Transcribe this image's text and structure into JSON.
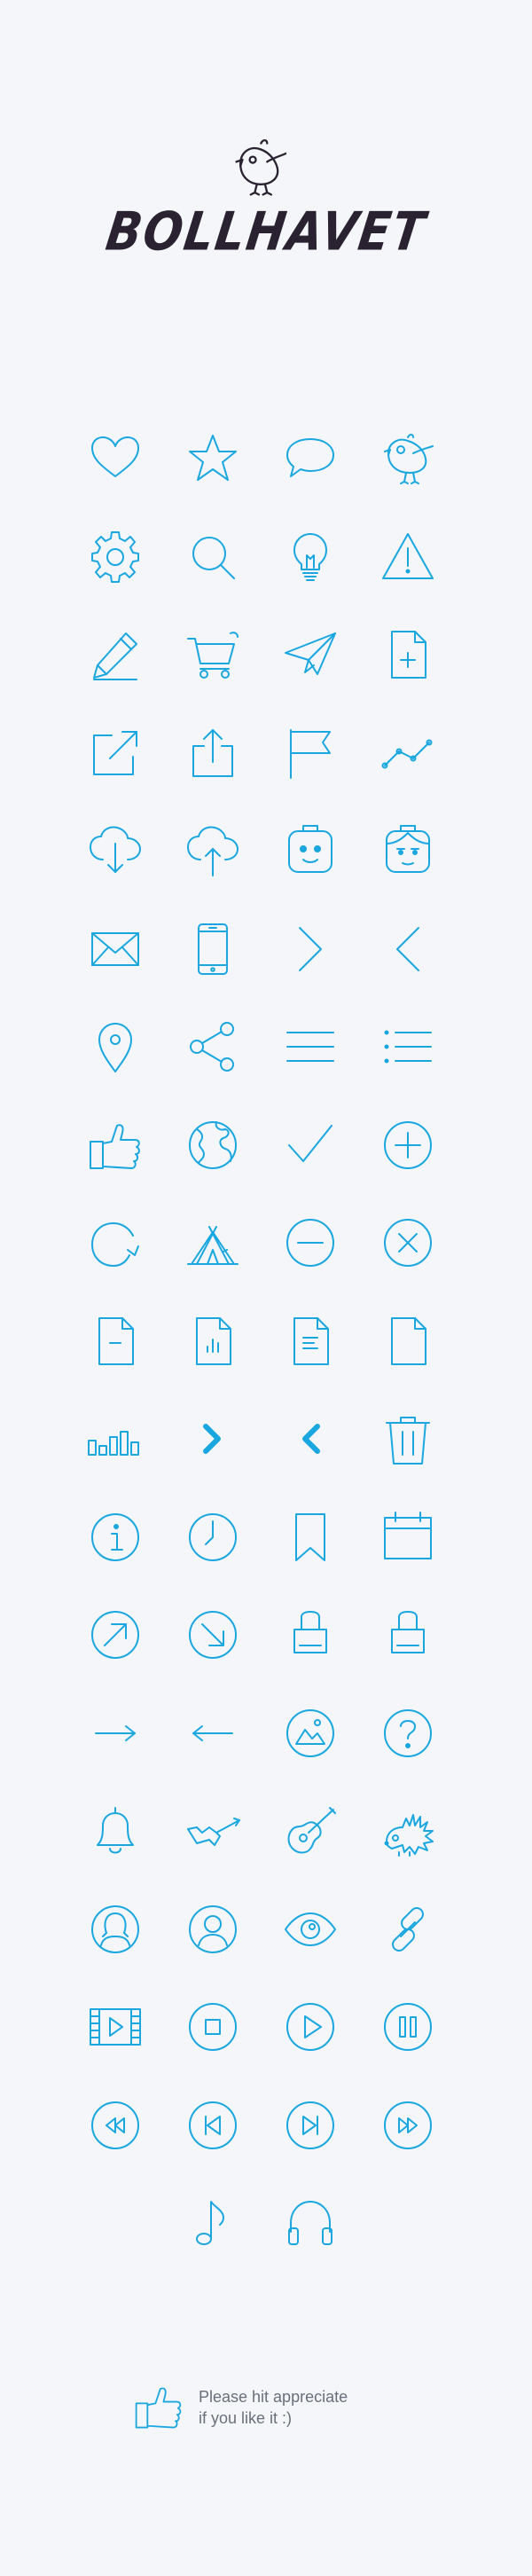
{
  "brand": {
    "title": "BOLLHAVET"
  },
  "accent_color": "#1aa7e0",
  "icons": [
    [
      "heart-icon",
      "star-icon",
      "speech-bubble-icon",
      "bird-icon"
    ],
    [
      "gear-icon",
      "search-icon",
      "lightbulb-icon",
      "warning-icon"
    ],
    [
      "pencil-icon",
      "shopping-cart-icon",
      "paper-plane-icon",
      "new-document-icon"
    ],
    [
      "external-link-icon",
      "share-upload-icon",
      "flag-icon",
      "line-graph-icon"
    ],
    [
      "cloud-download-icon",
      "cloud-upload-icon",
      "robot-face-icon",
      "girl-face-icon"
    ],
    [
      "envelope-icon",
      "smartphone-icon",
      "chevron-right-icon",
      "chevron-left-icon"
    ],
    [
      "map-pin-icon",
      "share-nodes-icon",
      "menu-icon",
      "list-icon"
    ],
    [
      "thumbs-up-icon",
      "globe-icon",
      "checkmark-icon",
      "plus-circle-icon"
    ],
    [
      "refresh-icon",
      "tent-icon",
      "minus-circle-icon",
      "close-circle-icon"
    ],
    [
      "document-minus-icon",
      "document-chart-icon",
      "document-text-icon",
      "blank-document-icon"
    ],
    [
      "bar-chart-icon",
      "chevron-right-bold-icon",
      "chevron-left-bold-icon",
      "trash-icon"
    ],
    [
      "info-icon",
      "clock-icon",
      "bookmark-icon",
      "calendar-icon"
    ],
    [
      "arrow-up-right-circle-icon",
      "arrow-down-right-circle-icon",
      "lego-brick-icon",
      "lego-brick-alt-icon"
    ],
    [
      "arrow-right-icon",
      "arrow-left-icon",
      "image-icon",
      "help-icon"
    ],
    [
      "bell-icon",
      "electric-guitar-icon",
      "acoustic-guitar-icon",
      "hedgehog-icon"
    ],
    [
      "user-female-icon",
      "user-icon",
      "eye-icon",
      "link-icon"
    ],
    [
      "video-icon",
      "stop-icon",
      "play-icon",
      "pause-icon"
    ],
    [
      "rewind-icon",
      "skip-back-icon",
      "skip-forward-icon",
      "fast-forward-icon"
    ],
    [
      "music-note-icon",
      "headphones-icon"
    ]
  ],
  "footer": {
    "line1": "Please hit appreciate",
    "line2": "if you like it :)"
  }
}
